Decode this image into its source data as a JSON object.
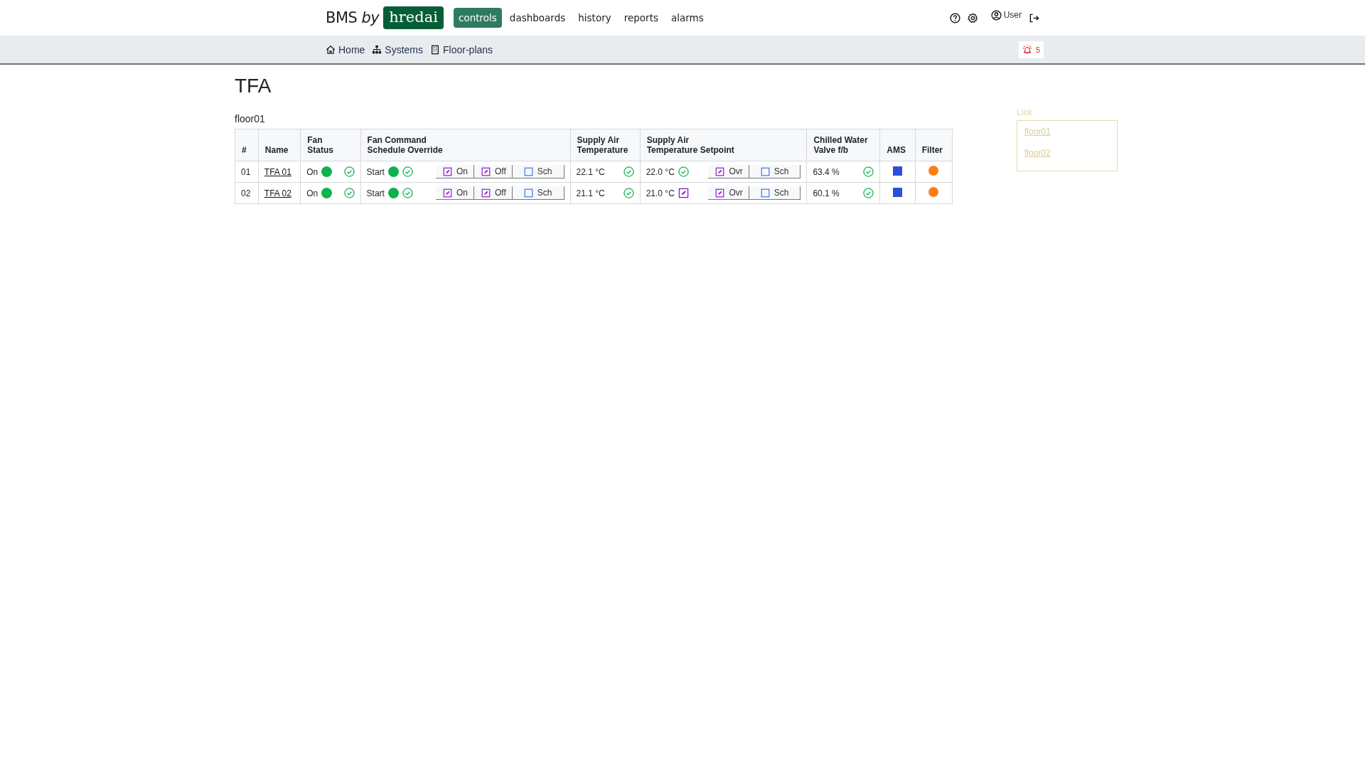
{
  "brand": {
    "prefix": "BMS",
    "by": "by",
    "logo": "hredai"
  },
  "top_nav": [
    {
      "label": "controls",
      "selected": true
    },
    {
      "label": "dashboards",
      "selected": false
    },
    {
      "label": "history",
      "selected": false
    },
    {
      "label": "reports",
      "selected": false
    },
    {
      "label": "alarms",
      "selected": false
    }
  ],
  "user": {
    "label": "User"
  },
  "sub_nav": [
    {
      "label": "Home",
      "kind": "home"
    },
    {
      "label": "Systems",
      "kind": "systems"
    },
    {
      "label": "Floor-plans",
      "kind": "building"
    }
  ],
  "alarm_badge": {
    "count": "5"
  },
  "page_title": "TFA",
  "section_title": "floor01",
  "table": {
    "columns": [
      "#",
      "Name",
      "Fan\nStatus",
      "Fan Command\nSchedule Override",
      "Supply Air\nTemperature",
      "Supply Air\nTemperature Setpoint",
      "Chilled Water\nValve f/b",
      "AMS",
      "Filter"
    ],
    "rows": [
      {
        "index": "01",
        "name": "TFA 01",
        "fan_status": {
          "text": "On",
          "on": true,
          "confirmed": true
        },
        "fan_command": {
          "text": "Start",
          "on": true,
          "confirmed": true,
          "buttons": [
            {
              "label": "On",
              "overridden": true
            },
            {
              "label": "Off",
              "overridden": true
            },
            {
              "label": "Sch",
              "overridden": false
            }
          ]
        },
        "supply_temp": {
          "text": "22.1 °C",
          "confirmed": true
        },
        "setpoint": {
          "text": "22.0 °C",
          "confirmed": true,
          "buttons": [
            {
              "label": "Ovr",
              "overridden": true
            },
            {
              "label": "Sch",
              "overridden": false
            }
          ]
        },
        "valve": {
          "text": "63.4 %",
          "confirmed": true
        },
        "ams": {
          "color": "#2a4fd8"
        },
        "filter": {
          "color": "#fd7e14"
        }
      },
      {
        "index": "02",
        "name": "TFA 02",
        "fan_status": {
          "text": "On",
          "on": true,
          "confirmed": true
        },
        "fan_command": {
          "text": "Start",
          "on": true,
          "confirmed": true,
          "buttons": [
            {
              "label": "On",
              "overridden": true
            },
            {
              "label": "Off",
              "overridden": true
            },
            {
              "label": "Sch",
              "overridden": false
            }
          ]
        },
        "supply_temp": {
          "text": "21.1 °C",
          "confirmed": true
        },
        "setpoint": {
          "text": "21.0 °C",
          "confirmed": false,
          "buttons": [
            {
              "label": "Ovr",
              "overridden": true
            },
            {
              "label": "Sch",
              "overridden": false
            }
          ]
        },
        "valve": {
          "text": "60.1 %",
          "confirmed": true
        },
        "ams": {
          "color": "#2a4fd8"
        },
        "filter": {
          "color": "#fd7e14"
        }
      }
    ]
  },
  "links": {
    "title": "Link",
    "items": [
      "floor01",
      "floor02"
    ]
  }
}
